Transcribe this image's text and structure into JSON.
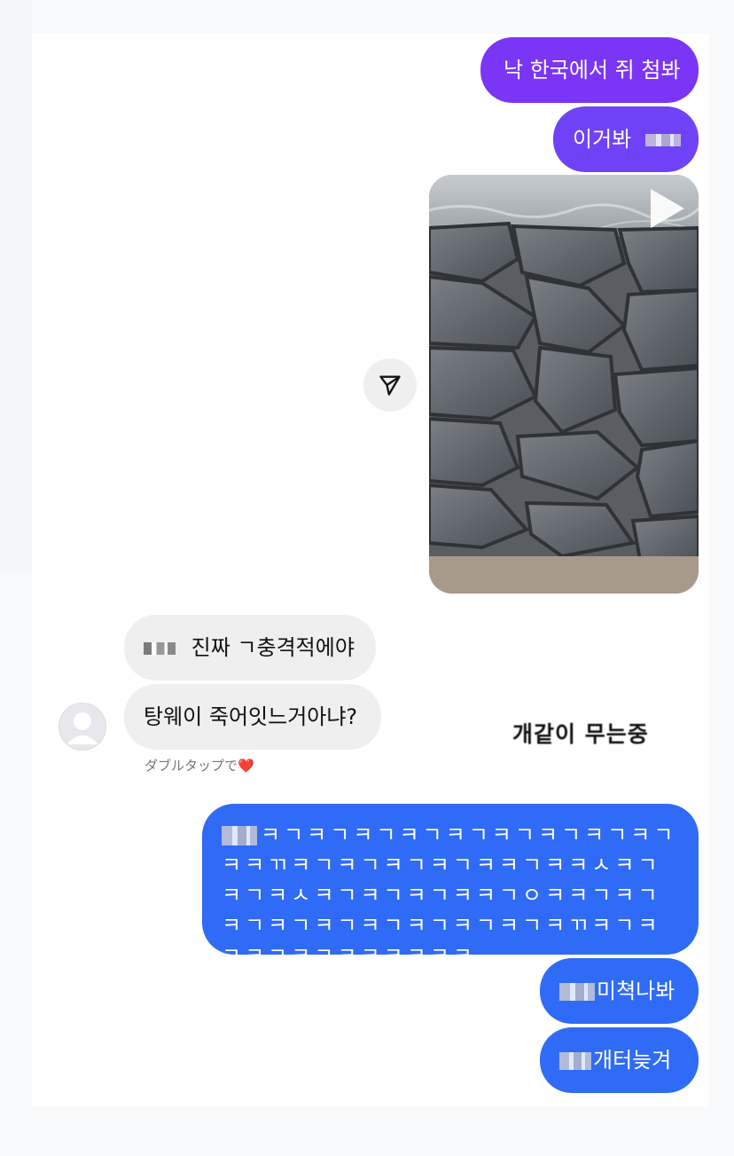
{
  "chat": {
    "messages": [
      {
        "id": "m1",
        "side": "out",
        "text": "낙 한국에서 쥐 첨봐"
      },
      {
        "id": "m2",
        "side": "out",
        "text": "이거봐"
      },
      {
        "id": "m4",
        "side": "in",
        "text": "진짜 ㄱ충격적에야"
      },
      {
        "id": "m5",
        "side": "in",
        "text": "탕웨이 죽어잇느거아냐?"
      },
      {
        "id": "m6",
        "side": "out",
        "text": "ㅋㄱㅋㄱㅋㄱㅋㄱㅋㄱㅋㄱㅋㄱㅋㄱㅋㄱㅋㅋㄲㅋㄱㅋㄱㅋㄱㅋㄱㅋㅋㄱㅋㅋㅅㅋㄱㅋㄱㅋㅅㅋㄱㅋㄱㅋㄱㅋㅋㄱㅇㅋㅋㄱㅋㄱㅋㄱㅋㄱㅋㄱㅋㄱㅋㄱㅋㄱㅋㄱㅋㄲㅋㄱㅋㄱㅋㄱㅋㄱㅋㅋㅋㅋㅋㅋ"
      },
      {
        "id": "m7",
        "side": "out",
        "text": "미쳑나봐"
      },
      {
        "id": "m8",
        "side": "out",
        "text": "개터늦겨"
      }
    ],
    "double_tap_hint": "ダブルタップで",
    "heart": "❤️",
    "overlay_caption": "개같이 무는중"
  },
  "icons": {
    "play": "play-icon",
    "share": "paper-plane-icon",
    "avatar": "default-avatar-icon"
  },
  "colors": {
    "bubble_purple": "#7b35f6",
    "bubble_blue": "#2f6bf6",
    "bubble_gray": "#efefef"
  }
}
